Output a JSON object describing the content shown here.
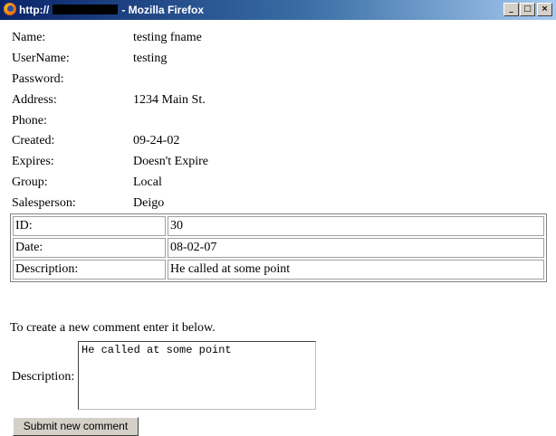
{
  "window": {
    "title_prefix": "http://",
    "title_suffix": "- Mozilla Firefox",
    "buttons": {
      "minimize": "_",
      "maximize": "□",
      "close": "×"
    }
  },
  "details": [
    {
      "label": "Name:",
      "value": "testing fname"
    },
    {
      "label": "UserName:",
      "value": "testing"
    },
    {
      "label": "Password:",
      "value": ""
    },
    {
      "label": "Address:",
      "value": "1234 Main St."
    },
    {
      "label": "Phone:",
      "value": ""
    },
    {
      "label": "Created:",
      "value": "09-24-02"
    },
    {
      "label": "Expires:",
      "value": "Doesn't Expire"
    },
    {
      "label": "Group:",
      "value": "Local"
    },
    {
      "label": "Salesperson:",
      "value": "Deigo"
    }
  ],
  "comment_table": [
    {
      "label": "ID:",
      "value": "30"
    },
    {
      "label": "Date:",
      "value": "08-02-07"
    },
    {
      "label": "Description:",
      "value": "He called at some point"
    }
  ],
  "form": {
    "intro": "To create a new comment enter it below.",
    "description_label": "Description:",
    "description_value": "He called at some point",
    "submit_label": "Submit new comment"
  }
}
